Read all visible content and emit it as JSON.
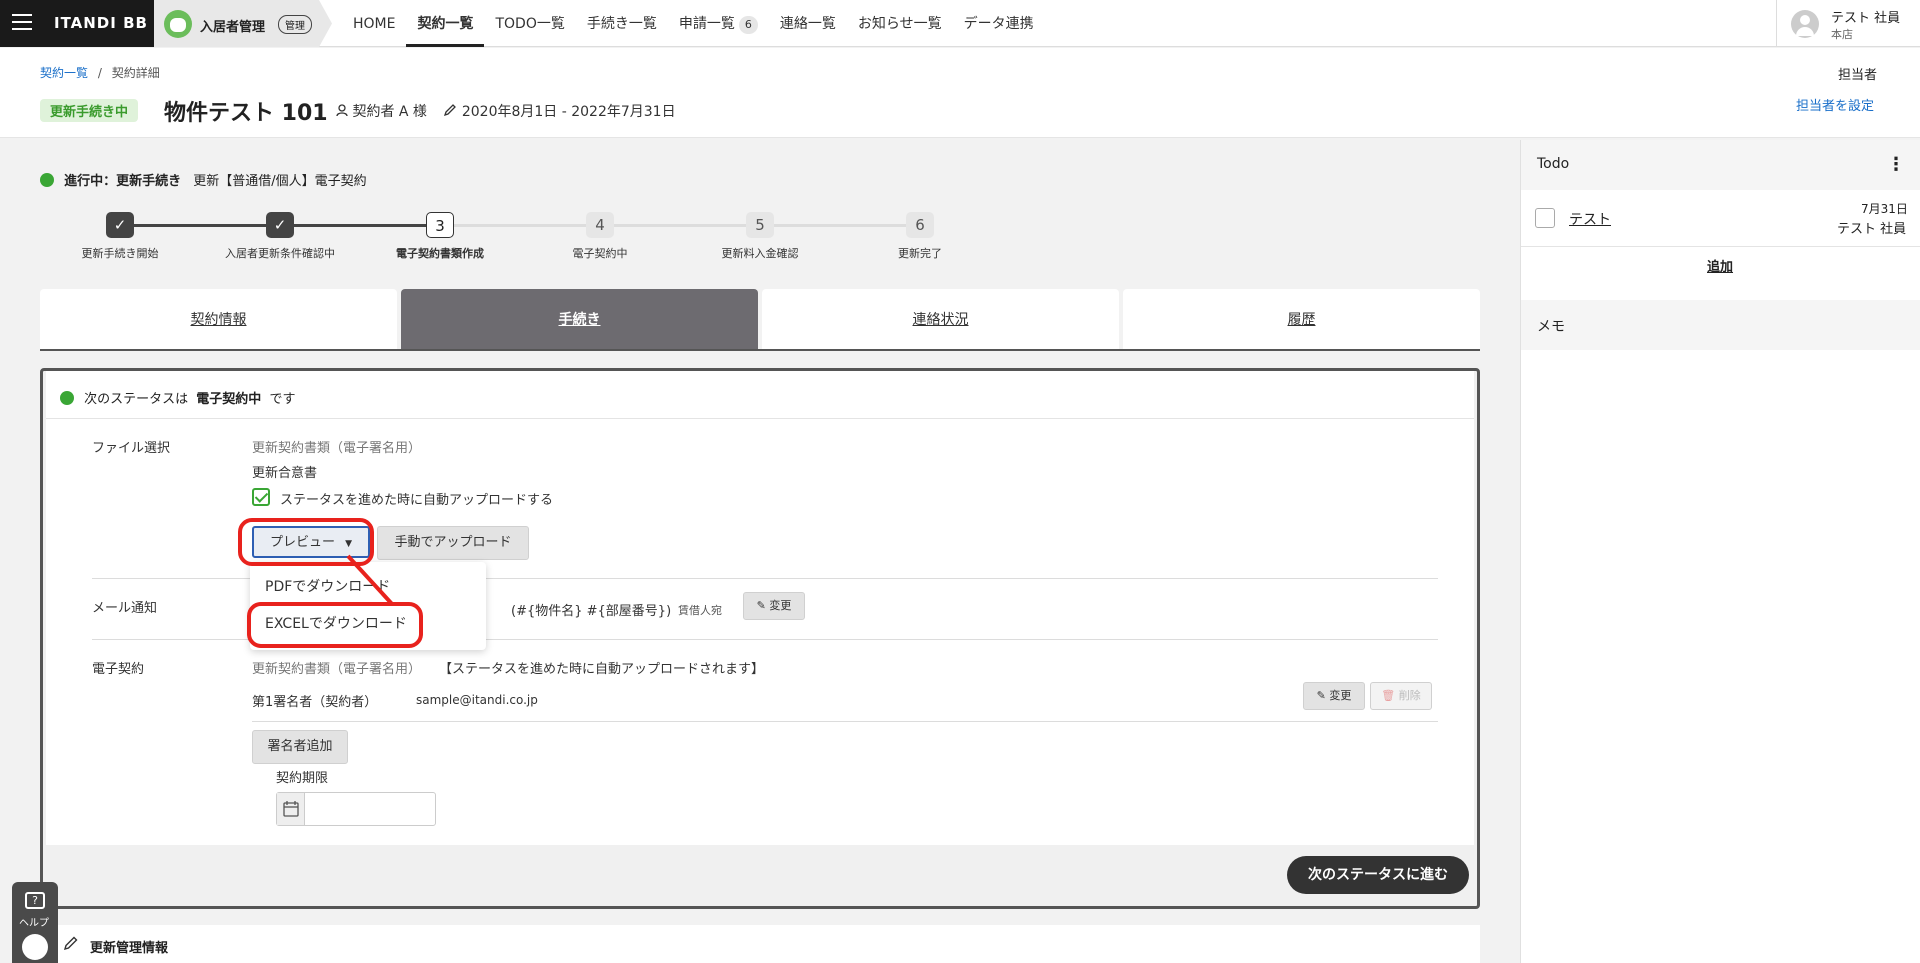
{
  "topbar": {
    "logo": "ITANDI BB",
    "app_name": "入居者管理",
    "app_badge": "管理",
    "nav": [
      {
        "label": "HOME"
      },
      {
        "label": "契約一覧"
      },
      {
        "label": "TODO一覧"
      },
      {
        "label": "手続き一覧"
      },
      {
        "label": "申請一覧",
        "count": "6"
      },
      {
        "label": "連絡一覧"
      },
      {
        "label": "お知らせ一覧"
      },
      {
        "label": "データ連携"
      }
    ],
    "user_name": "テスト 社員",
    "user_branch": "本店"
  },
  "breadcrumb": {
    "link": "契約一覧",
    "sep": "/",
    "current": "契約詳細"
  },
  "header": {
    "status": "更新手続き中",
    "title": "物件テスト 101",
    "contractor": "契約者 A 様",
    "period": "2020年8月1日 - 2022年7月31日",
    "owner_label": "担当者",
    "owner_link": "担当者を設定"
  },
  "progress": {
    "head_bold": "進行中：更新手続き",
    "head_rest": "更新【普通借/個人】電子契約",
    "steps": [
      {
        "num": "",
        "label": "更新手続き開始",
        "state": "done"
      },
      {
        "num": "",
        "label": "入居者更新条件確認中",
        "state": "done"
      },
      {
        "num": "3",
        "label": "電子契約書類作成",
        "state": "current"
      },
      {
        "num": "4",
        "label": "電子契約中",
        "state": "todo"
      },
      {
        "num": "5",
        "label": "更新料入金確認",
        "state": "todo"
      },
      {
        "num": "6",
        "label": "更新完了",
        "state": "todo"
      }
    ]
  },
  "tabs": [
    {
      "label": "契約情報"
    },
    {
      "label": "手続き"
    },
    {
      "label": "連絡状況"
    },
    {
      "label": "履歴"
    }
  ],
  "panel": {
    "next_pre": "次のステータスは",
    "next_bold": "電子契約中",
    "next_post": "です",
    "file_label": "ファイル選択",
    "file_gray": "更新契約書類（電子署名用）",
    "file_name": "更新合意書",
    "auto_upload": "ステータスを進めた時に自動アップロードする",
    "preview_btn": "プレビュー",
    "manual_btn": "手動でアップロード",
    "mail_label": "メール通知",
    "mail_subject": "(#{物件名} #{部屋番号})",
    "mail_to": "賃借人宛",
    "mail_change": "変更",
    "econtract_label": "電子契約",
    "econtract_gray": "更新契約書類（電子署名用）",
    "econtract_note": "【ステータスを進めた時に自動アップロードされます】",
    "signer_label": "第1署名者（契約者）",
    "signer_email": "sample@itandi.co.jp",
    "signer_change": "変更",
    "signer_delete": "削除",
    "add_signer": "署名者追加",
    "deadline_label": "契約期限",
    "next_button": "次のステータスに進む"
  },
  "dropdown": {
    "items": [
      {
        "label": "PDFでダウンロード"
      },
      {
        "label": "EXCELでダウンロード"
      }
    ]
  },
  "side": {
    "todo_title": "Todo",
    "todo_item": "テスト",
    "todo_date": "7月31日",
    "todo_who": "テスト 社員",
    "todo_add": "追加",
    "memo_title": "メモ"
  },
  "bottom": {
    "title": "更新管理情報"
  },
  "help": {
    "label": "ヘルプ",
    "q": "?"
  },
  "colors": {
    "accent_green": "#3aa635",
    "highlight_red": "#e8221d",
    "active_tab": "#6d6b70",
    "link_blue": "#1a6fc9"
  }
}
